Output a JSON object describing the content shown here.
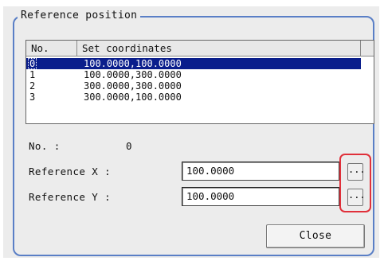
{
  "group": {
    "title": "Reference position"
  },
  "list": {
    "headers": {
      "no": "No.",
      "coords": "Set coordinates"
    },
    "rows": [
      {
        "no": "0",
        "coords": "100.0000,100.0000",
        "selected": true
      },
      {
        "no": "1",
        "coords": "100.0000,300.0000",
        "selected": false
      },
      {
        "no": "2",
        "coords": "300.0000,300.0000",
        "selected": false
      },
      {
        "no": "3",
        "coords": "300.0000,100.0000",
        "selected": false
      }
    ]
  },
  "fields": {
    "no_label": "No. :",
    "no_value": "0",
    "ref_x_label": "Reference X :",
    "ref_x_value": "100.0000",
    "ref_y_label": "Reference Y :",
    "ref_y_value": "100.0000",
    "browse_label": "..."
  },
  "buttons": {
    "close": "Close"
  },
  "colors": {
    "group_border": "#5a7fc6",
    "selection": "#0a1e8c",
    "highlight": "#e0303a"
  }
}
